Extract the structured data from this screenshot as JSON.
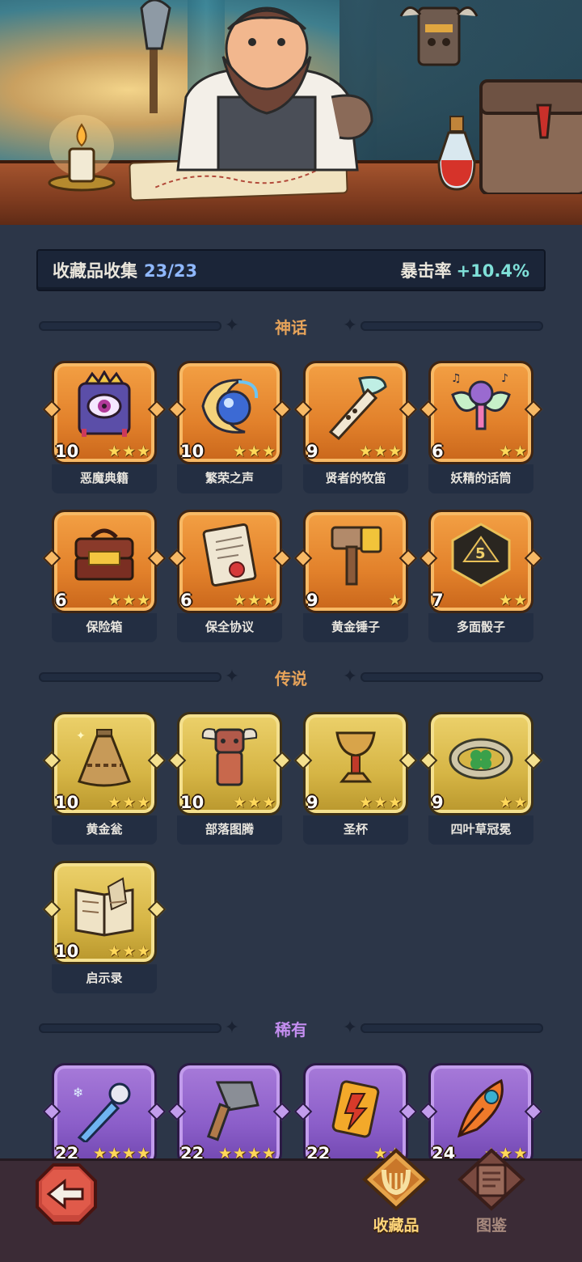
{
  "collection": {
    "label": "收藏品收集",
    "count": "23/23",
    "crit_label": "暴击率",
    "crit_value": "+10.4%"
  },
  "sections": [
    {
      "title": "神话",
      "tier": "mythic",
      "items": [
        {
          "name": "恶魔典籍",
          "level": "10",
          "stars": 3,
          "icon": "demon-tome-icon"
        },
        {
          "name": "繁荣之声",
          "level": "10",
          "stars": 3,
          "icon": "prosperity-orb-icon"
        },
        {
          "name": "贤者的牧笛",
          "level": "9",
          "stars": 3,
          "icon": "sage-flute-icon"
        },
        {
          "name": "妖精的话筒",
          "level": "6",
          "stars": 2,
          "icon": "fairy-microphone-icon"
        },
        {
          "name": "保险箱",
          "level": "6",
          "stars": 3,
          "icon": "treasure-chest-icon"
        },
        {
          "name": "保全协议",
          "level": "6",
          "stars": 3,
          "icon": "contract-scroll-icon"
        },
        {
          "name": "黄金锤子",
          "level": "9",
          "stars": 1,
          "icon": "golden-hammer-icon"
        },
        {
          "name": "多面骰子",
          "level": "7",
          "stars": 2,
          "icon": "polyhedral-dice-icon"
        }
      ]
    },
    {
      "title": "传说",
      "tier": "legend",
      "items": [
        {
          "name": "黄金瓮",
          "level": "10",
          "stars": 3,
          "icon": "golden-urn-icon"
        },
        {
          "name": "部落图腾",
          "level": "10",
          "stars": 3,
          "icon": "tribal-totem-icon"
        },
        {
          "name": "圣杯",
          "level": "9",
          "stars": 3,
          "icon": "holy-grail-icon"
        },
        {
          "name": "四叶草冠冕",
          "level": "9",
          "stars": 2,
          "icon": "clover-crown-icon"
        },
        {
          "name": "启示录",
          "level": "10",
          "stars": 3,
          "icon": "revelation-book-icon"
        }
      ]
    },
    {
      "title": "稀有",
      "tier": "rare",
      "items": [
        {
          "name": "",
          "level": "22",
          "stars": 4,
          "icon": "frost-dagger-icon"
        },
        {
          "name": "",
          "level": "22",
          "stars": 4,
          "icon": "stone-axe-icon"
        },
        {
          "name": "",
          "level": "22",
          "stars": 2,
          "icon": "lightning-card-icon"
        },
        {
          "name": "",
          "level": "24",
          "stars": 3,
          "icon": "flame-feather-icon"
        }
      ]
    }
  ],
  "bottom_nav": {
    "back_icon": "back-arrow-icon",
    "tabs": [
      {
        "label": "收藏品",
        "icon": "collection-lyre-icon",
        "active": true
      },
      {
        "label": "图鉴",
        "icon": "codex-book-icon",
        "active": false
      }
    ]
  },
  "colors": {
    "mythic": "#e2812b",
    "legend": "#d6b545",
    "rare": "#8b5ec9",
    "accent_title": "#e6a35a",
    "count_blue": "#8fb8ff",
    "crit_teal": "#7fe0d8"
  }
}
